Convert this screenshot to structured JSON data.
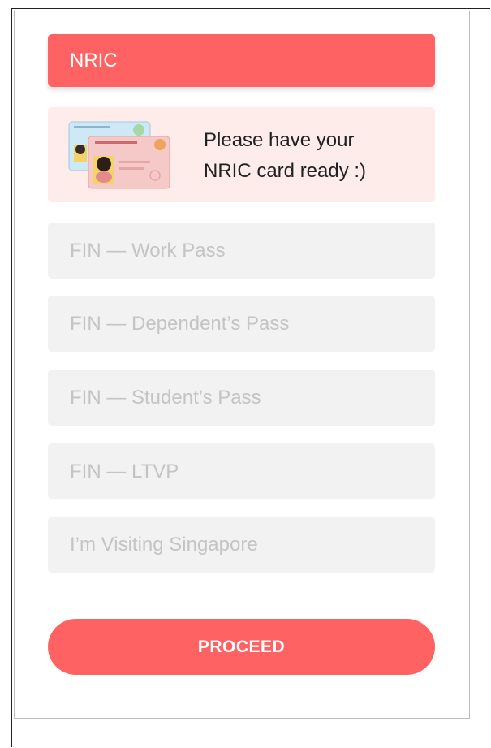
{
  "id_options": {
    "selected": {
      "label": "NRIC"
    },
    "info_card": {
      "line1": "Please have your",
      "line2": "NRIC card ready :)"
    },
    "others": [
      {
        "label": "FIN — Work Pass"
      },
      {
        "label": "FIN — Dependent’s Pass"
      },
      {
        "label": "FIN — Student’s Pass"
      },
      {
        "label": "FIN — LTVP"
      },
      {
        "label": "I’m Visiting Singapore"
      }
    ]
  },
  "proceed_button": {
    "label": "PROCEED"
  },
  "colors": {
    "accent": "#ff6262",
    "info_background": "#fdecea",
    "option_background": "#f2f2f2",
    "option_text": "#c4c4c4"
  }
}
